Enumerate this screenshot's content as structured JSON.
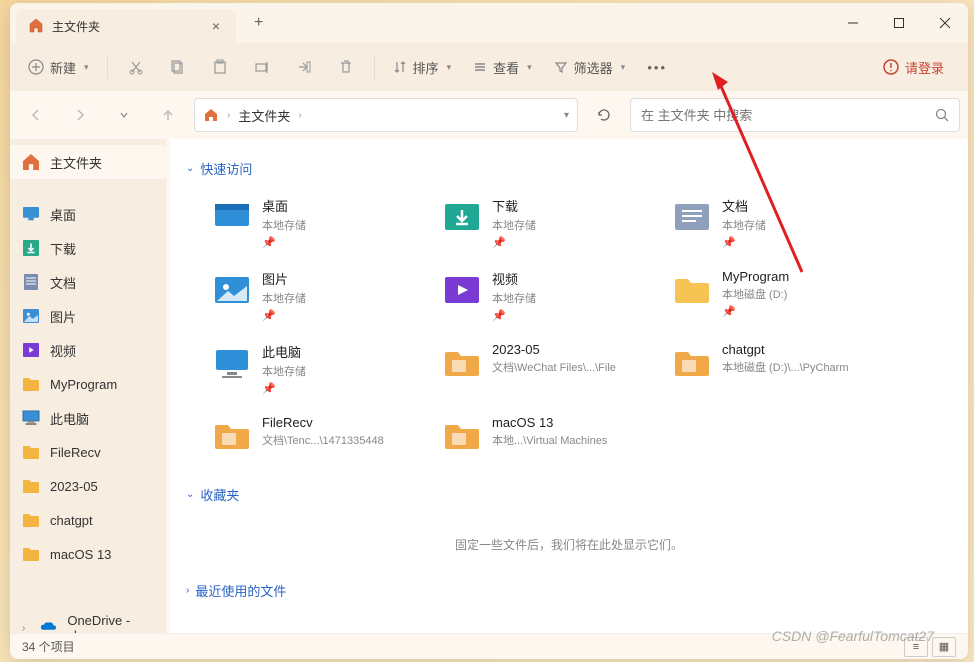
{
  "tab": {
    "title": "主文件夹"
  },
  "toolbar": {
    "new_label": "新建",
    "sort_label": "排序",
    "view_label": "查看",
    "filter_label": "筛选器",
    "login_label": "请登录"
  },
  "breadcrumb": {
    "root": "主文件夹"
  },
  "search": {
    "placeholder": "在 主文件夹 中搜索"
  },
  "sidebar": {
    "items": [
      {
        "label": "主文件夹",
        "icon": "home",
        "active": true
      },
      {
        "label": "桌面",
        "icon": "desktop"
      },
      {
        "label": "下载",
        "icon": "download"
      },
      {
        "label": "文档",
        "icon": "document"
      },
      {
        "label": "图片",
        "icon": "pictures"
      },
      {
        "label": "视频",
        "icon": "videos"
      },
      {
        "label": "MyProgram",
        "icon": "folder"
      },
      {
        "label": "此电脑",
        "icon": "pc"
      },
      {
        "label": "FileRecv",
        "icon": "folder"
      },
      {
        "label": "2023-05",
        "icon": "folder"
      },
      {
        "label": "chatgpt",
        "icon": "folder"
      },
      {
        "label": "macOS 13",
        "icon": "folder"
      }
    ],
    "onedrive": "OneDrive - yhu"
  },
  "sections": {
    "quick": "快速访问",
    "favorites": "收藏夹",
    "recent": "最近使用的文件",
    "favorites_empty": "固定一些文件后，我们将在此处显示它们。"
  },
  "quick_items": [
    {
      "name": "桌面",
      "sub": "本地存储",
      "icon": "desktop-blue",
      "pinned": true
    },
    {
      "name": "下载",
      "sub": "本地存储",
      "icon": "download-teal",
      "pinned": true
    },
    {
      "name": "文档",
      "sub": "本地存储",
      "icon": "document-gray",
      "pinned": true
    },
    {
      "name": "图片",
      "sub": "本地存储",
      "icon": "pictures-blue",
      "pinned": true
    },
    {
      "name": "视频",
      "sub": "本地存储",
      "icon": "videos-purple",
      "pinned": true
    },
    {
      "name": "MyProgram",
      "sub": "本地磁盘 (D:)",
      "icon": "folder-yellow",
      "pinned": true
    },
    {
      "name": "此电脑",
      "sub": "本地存储",
      "icon": "pc-blue",
      "pinned": true
    },
    {
      "name": "2023-05",
      "sub": "文档\\WeChat Files\\...\\File",
      "icon": "folder-orange",
      "pinned": false
    },
    {
      "name": "chatgpt",
      "sub": "本地磁盘 (D:)\\...\\PyCharm",
      "icon": "folder-orange",
      "pinned": false
    },
    {
      "name": "FileRecv",
      "sub": "文档\\Tenc...\\1471335448",
      "icon": "folder-orange",
      "pinned": false
    },
    {
      "name": "macOS 13",
      "sub": "本地...\\Virtual Machines",
      "icon": "folder-orange",
      "pinned": false
    }
  ],
  "status": {
    "count": "34 个项目"
  },
  "watermark": "CSDN @FearfulTomcat27"
}
